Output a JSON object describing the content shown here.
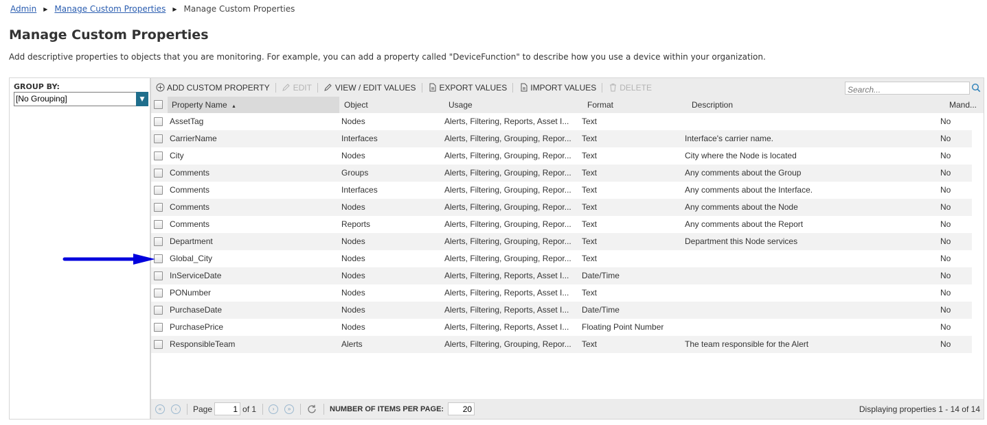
{
  "breadcrumb": {
    "items": [
      "Admin",
      "Manage Custom Properties"
    ],
    "current": "Manage Custom Properties"
  },
  "page": {
    "title": "Manage Custom Properties",
    "description": "Add descriptive properties to objects that you are monitoring. For example, you can add a property called \"DeviceFunction\" to describe how you use a device within your organization."
  },
  "group_by": {
    "label": "GROUP BY:",
    "selected": "[No Grouping]"
  },
  "toolbar": {
    "add": "ADD CUSTOM PROPERTY",
    "edit": "EDIT",
    "view_edit": "VIEW / EDIT VALUES",
    "export": "EXPORT VALUES",
    "import": "IMPORT VALUES",
    "delete": "DELETE",
    "search_placeholder": "Search..."
  },
  "columns": {
    "name": "Property Name",
    "object": "Object",
    "usage": "Usage",
    "format": "Format",
    "description": "Description",
    "mandatory": "Mand..."
  },
  "rows": [
    {
      "name": "AssetTag",
      "object": "Nodes",
      "usage": "Alerts, Filtering, Reports, Asset I...",
      "format": "Text",
      "description": "",
      "mandatory": "No"
    },
    {
      "name": "CarrierName",
      "object": "Interfaces",
      "usage": "Alerts, Filtering, Grouping, Repor...",
      "format": "Text",
      "description": "Interface's carrier name.",
      "mandatory": "No"
    },
    {
      "name": "City",
      "object": "Nodes",
      "usage": "Alerts, Filtering, Grouping, Repor...",
      "format": "Text",
      "description": "City where the Node is located",
      "mandatory": "No"
    },
    {
      "name": "Comments",
      "object": "Groups",
      "usage": "Alerts, Filtering, Grouping, Repor...",
      "format": "Text",
      "description": "Any comments about the Group",
      "mandatory": "No"
    },
    {
      "name": "Comments",
      "object": "Interfaces",
      "usage": "Alerts, Filtering, Grouping, Repor...",
      "format": "Text",
      "description": "Any comments about the Interface.",
      "mandatory": "No"
    },
    {
      "name": "Comments",
      "object": "Nodes",
      "usage": "Alerts, Filtering, Grouping, Repor...",
      "format": "Text",
      "description": "Any comments about the Node",
      "mandatory": "No"
    },
    {
      "name": "Comments",
      "object": "Reports",
      "usage": "Alerts, Filtering, Grouping, Repor...",
      "format": "Text",
      "description": "Any comments about the Report",
      "mandatory": "No"
    },
    {
      "name": "Department",
      "object": "Nodes",
      "usage": "Alerts, Filtering, Grouping, Repor...",
      "format": "Text",
      "description": "Department this Node services",
      "mandatory": "No"
    },
    {
      "name": "Global_City",
      "object": "Nodes",
      "usage": "Alerts, Filtering, Grouping, Repor...",
      "format": "Text",
      "description": "",
      "mandatory": "No"
    },
    {
      "name": "InServiceDate",
      "object": "Nodes",
      "usage": "Alerts, Filtering, Reports, Asset I...",
      "format": "Date/Time",
      "description": "",
      "mandatory": "No"
    },
    {
      "name": "PONumber",
      "object": "Nodes",
      "usage": "Alerts, Filtering, Reports, Asset I...",
      "format": "Text",
      "description": "",
      "mandatory": "No"
    },
    {
      "name": "PurchaseDate",
      "object": "Nodes",
      "usage": "Alerts, Filtering, Reports, Asset I...",
      "format": "Date/Time",
      "description": "",
      "mandatory": "No"
    },
    {
      "name": "PurchasePrice",
      "object": "Nodes",
      "usage": "Alerts, Filtering, Reports, Asset I...",
      "format": "Floating Point Number",
      "description": "",
      "mandatory": "No"
    },
    {
      "name": "ResponsibleTeam",
      "object": "Alerts",
      "usage": "Alerts, Filtering, Grouping, Repor...",
      "format": "Text",
      "description": "The team responsible for the Alert",
      "mandatory": "No"
    }
  ],
  "footer": {
    "page_label": "Page",
    "page_value": "1",
    "of_label": "of 1",
    "items_label": "NUMBER OF ITEMS PER PAGE:",
    "items_value": "20",
    "displaying": "Displaying properties 1 - 14 of 14"
  },
  "colors": {
    "link": "#2a5db0",
    "select_arrow": "#1f6e8c",
    "annotation_arrow": "#0000dd"
  }
}
